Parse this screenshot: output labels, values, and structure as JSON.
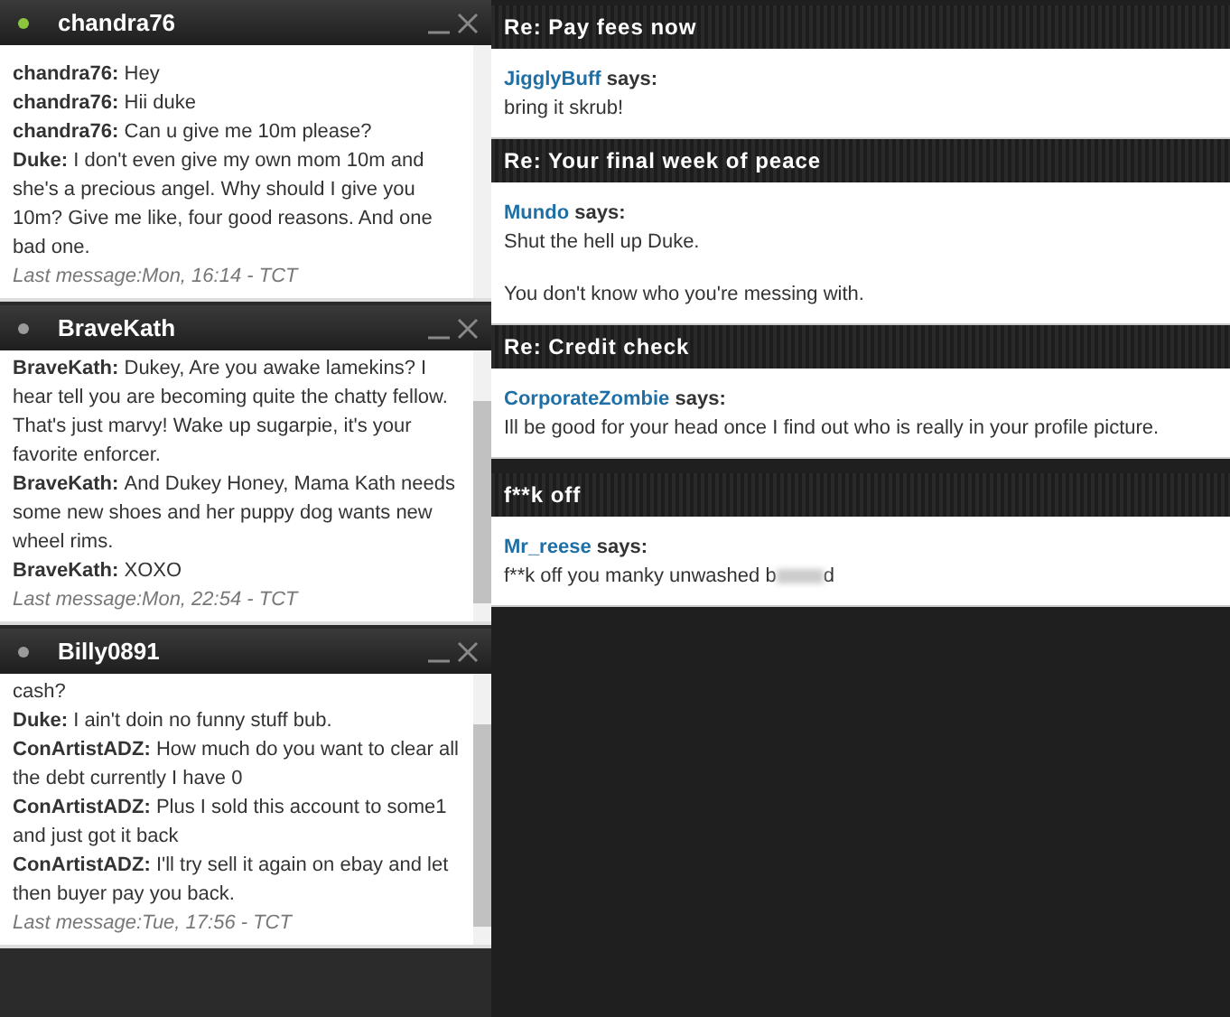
{
  "chats": [
    {
      "name": "chandra76",
      "color": "#8cc63f",
      "scrolled": false,
      "lines": [
        {
          "sender": "chandra76:",
          "text": "Hey"
        },
        {
          "sender": "chandra76:",
          "text": "Hii duke"
        },
        {
          "sender": "chandra76:",
          "text": "Can u give me 10m please?"
        },
        {
          "sender": "Duke:",
          "text": "I don't even give my own mom 10m and she's a precious angel. Why should I give you 10m? Give me like, four good reasons. And one bad one."
        }
      ],
      "last_message": "Last message:Mon, 16:14 - TCT"
    },
    {
      "name": "BraveKath",
      "color": "#9a9a9a",
      "scrolled": true,
      "lines": [
        {
          "sender": "BraveKath:",
          "text": "Dukey, Are you awake lamekins? I hear tell you are becoming quite the chatty fellow. That's just marvy! Wake up sugarpie, it's your favorite enforcer."
        },
        {
          "sender": "BraveKath:",
          "text": "And Dukey Honey, Mama Kath needs some new shoes and her puppy dog wants new wheel rims."
        },
        {
          "sender": "BraveKath:",
          "text": "XOXO"
        }
      ],
      "last_message": "Last message:Mon, 22:54 - TCT"
    },
    {
      "name": "Billy0891",
      "color": "#9a9a9a",
      "scrolled": true,
      "lines": [
        {
          "text": "cash?"
        },
        {
          "sender": "Duke:",
          "text": "I ain't doin no funny stuff bub."
        },
        {
          "sender": "ConArtistADZ:",
          "text": "How much do you want to clear all the debt currently I have 0"
        },
        {
          "sender": "ConArtistADZ:",
          "text": "Plus I sold this account to some1 and just got it back"
        },
        {
          "sender": "ConArtistADZ:",
          "text": "I'll try sell it again on ebay and let then buyer pay you back."
        }
      ],
      "last_message": "Last message:Tue, 17:56 - TCT"
    }
  ],
  "threads": [
    {
      "title": "Re: Pay fees now",
      "author": "JigglyBuff",
      "says": "says:",
      "paragraphs": [
        "bring it skrub!"
      ]
    },
    {
      "title": "Re: Your final week of peace",
      "author": "Mundo",
      "says": "says:",
      "paragraphs": [
        "Shut the hell up Duke.",
        "You don't know who you're messing with."
      ]
    },
    {
      "title": "Re: Credit check",
      "author": "CorporateZombie",
      "says": "says:",
      "paragraphs": [
        "Ill be good for your head once I find out who is really in your profile picture."
      ]
    },
    {
      "title": "f**k off",
      "author": "Mr_reese",
      "says": "says:",
      "paragraphs": [
        "f**k off you manky unwashed b"
      ],
      "censored": true,
      "tail": "d"
    }
  ]
}
